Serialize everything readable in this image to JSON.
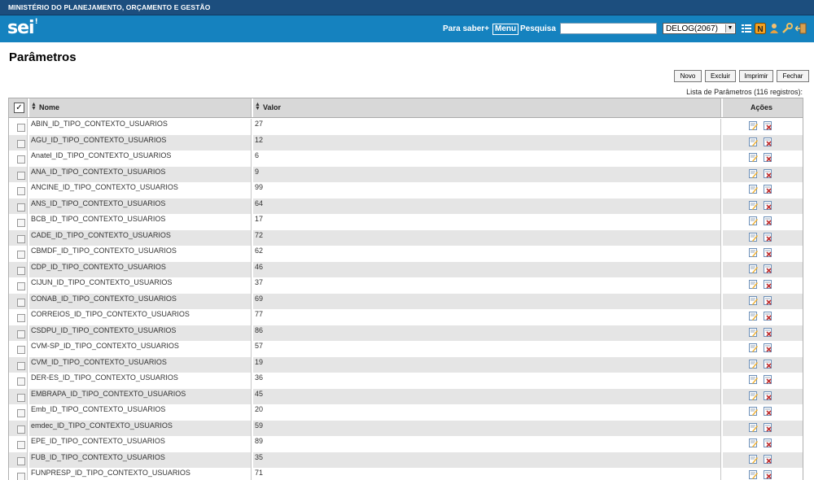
{
  "header": {
    "ministry": "MINISTÉRIO DO PLANEJAMENTO, ORÇAMENTO E GESTÃO",
    "logo_text": "sei",
    "logo_mark": "!",
    "help_label": "Para saber+",
    "menu_label": "Menu",
    "search_label": "Pesquisa",
    "search_value": "",
    "unit": "DELOG(2067)",
    "icons": [
      "grid-icon",
      "n-icon",
      "user-icon",
      "wrench-icon",
      "exit-icon"
    ]
  },
  "page": {
    "title": "Parâmetros",
    "buttons": {
      "new": "Novo",
      "delete": "Excluir",
      "print": "Imprimir",
      "close": "Fechar"
    },
    "caption": "Lista de Parâmetros (116 registros):"
  },
  "table": {
    "headers": {
      "check": "✓",
      "name": "Nome",
      "value": "Valor",
      "actions": "Ações"
    },
    "rows": [
      {
        "name": "ABIN_ID_TIPO_CONTEXTO_USUARIOS",
        "value": "27"
      },
      {
        "name": "AGU_ID_TIPO_CONTEXTO_USUARIOS",
        "value": "12"
      },
      {
        "name": "Anatel_ID_TIPO_CONTEXTO_USUARIOS",
        "value": "6"
      },
      {
        "name": "ANA_ID_TIPO_CONTEXTO_USUARIOS",
        "value": "9"
      },
      {
        "name": "ANCINE_ID_TIPO_CONTEXTO_USUARIOS",
        "value": "99"
      },
      {
        "name": "ANS_ID_TIPO_CONTEXTO_USUARIOS",
        "value": "64"
      },
      {
        "name": "BCB_ID_TIPO_CONTEXTO_USUARIOS",
        "value": "17"
      },
      {
        "name": "CADE_ID_TIPO_CONTEXTO_USUARIOS",
        "value": "72"
      },
      {
        "name": "CBMDF_ID_TIPO_CONTEXTO_USUARIOS",
        "value": "62"
      },
      {
        "name": "CDP_ID_TIPO_CONTEXTO_USUARIOS",
        "value": "46"
      },
      {
        "name": "CIJUN_ID_TIPO_CONTEXTO_USUARIOS",
        "value": "37"
      },
      {
        "name": "CONAB_ID_TIPO_CONTEXTO_USUARIOS",
        "value": "69"
      },
      {
        "name": "CORREIOS_ID_TIPO_CONTEXTO_USUARIOS",
        "value": "77"
      },
      {
        "name": "CSDPU_ID_TIPO_CONTEXTO_USUARIOS",
        "value": "86"
      },
      {
        "name": "CVM-SP_ID_TIPO_CONTEXTO_USUARIOS",
        "value": "57"
      },
      {
        "name": "CVM_ID_TIPO_CONTEXTO_USUARIOS",
        "value": "19"
      },
      {
        "name": "DER-ES_ID_TIPO_CONTEXTO_USUARIOS",
        "value": "36"
      },
      {
        "name": "EMBRAPA_ID_TIPO_CONTEXTO_USUARIOS",
        "value": "45"
      },
      {
        "name": "Emb_ID_TIPO_CONTEXTO_USUARIOS",
        "value": "20"
      },
      {
        "name": "emdec_ID_TIPO_CONTEXTO_USUARIOS",
        "value": "59"
      },
      {
        "name": "EPE_ID_TIPO_CONTEXTO_USUARIOS",
        "value": "89"
      },
      {
        "name": "FUB_ID_TIPO_CONTEXTO_USUARIOS",
        "value": "35"
      },
      {
        "name": "FUNPRESP_ID_TIPO_CONTEXTO_USUARIOS",
        "value": "71"
      }
    ],
    "row_action_icons": [
      "edit-icon",
      "delete-icon"
    ]
  },
  "colors": {
    "ministry_bar": "#1c4e7e",
    "top_bar": "#1582bf",
    "row_alt": "#e5e5e5",
    "header_bg": "#d8d8d8"
  }
}
